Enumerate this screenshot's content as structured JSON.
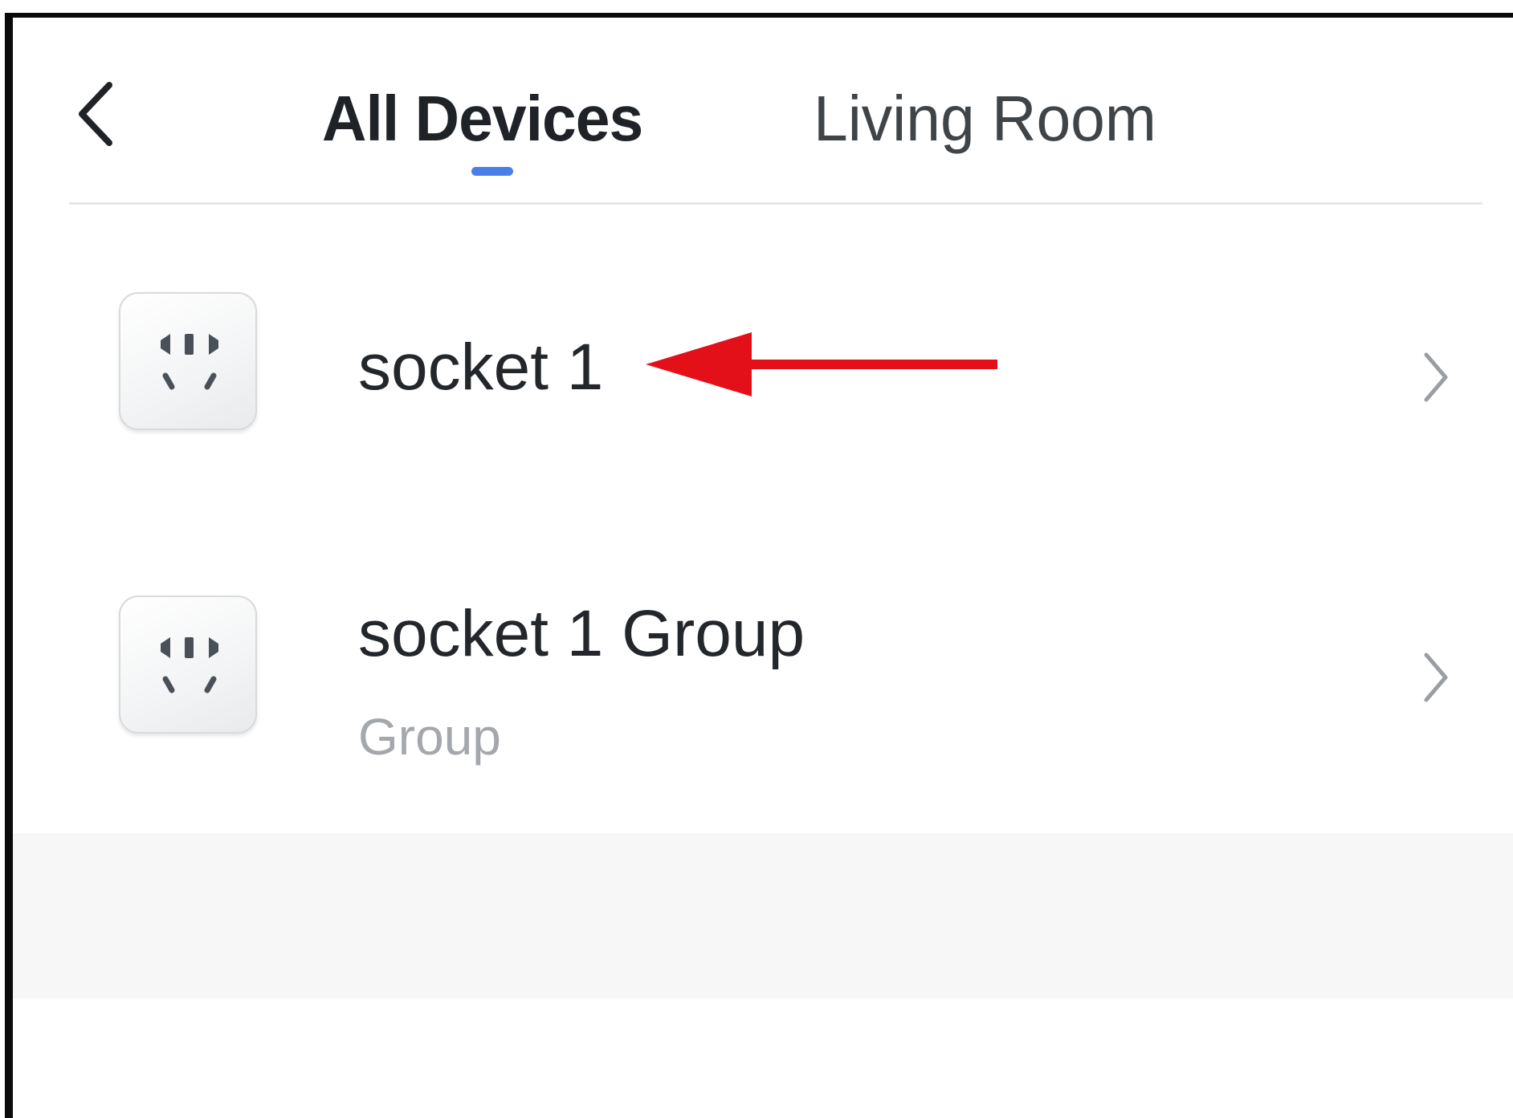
{
  "header": {
    "back_icon": "chevron-left-icon",
    "tabs": [
      {
        "label": "All Devices",
        "active": true
      },
      {
        "label": "Living Room",
        "active": false
      }
    ],
    "indicator_color": "#4a7fe8"
  },
  "devices": [
    {
      "name": "socket 1",
      "subtitle": "",
      "icon": "socket-icon"
    },
    {
      "name": "socket 1 Group",
      "subtitle": "Group",
      "icon": "socket-icon"
    }
  ],
  "annotation": {
    "icon": "red-arrow-icon",
    "color": "#e3101a"
  },
  "row_action_icon": "chevron-right-icon"
}
